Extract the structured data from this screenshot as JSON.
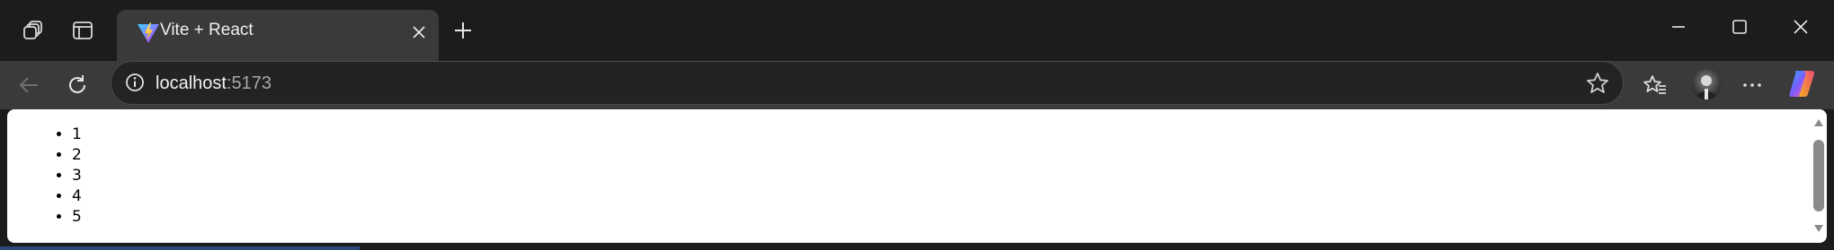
{
  "tab": {
    "title": "Vite + React",
    "favicon": "vite-logo-icon"
  },
  "address_bar": {
    "host": "localhost",
    "port": ":5173"
  },
  "page": {
    "list_items": [
      "1",
      "2",
      "3",
      "4",
      "5"
    ]
  },
  "colors": {
    "chrome_bg": "#1c1c1c",
    "toolbar_bg": "#3a3a3a",
    "omnibox_bg": "#232323",
    "page_bg": "#ffffff",
    "text_primary": "#f2f2f2",
    "text_secondary": "#a8a8a8"
  },
  "icons": {
    "workspaces": "workspaces-icon",
    "tab_actions": "tab-actions-icon",
    "new_tab": "plus-icon",
    "minimize": "minimize-icon",
    "maximize": "maximize-icon",
    "close_window": "close-icon",
    "back": "back-arrow-icon",
    "refresh": "refresh-icon",
    "site_info": "info-icon",
    "favorite": "star-icon",
    "favorites": "favorites-icon",
    "profile": "avatar",
    "more": "more-icon",
    "copilot": "copilot-icon"
  }
}
